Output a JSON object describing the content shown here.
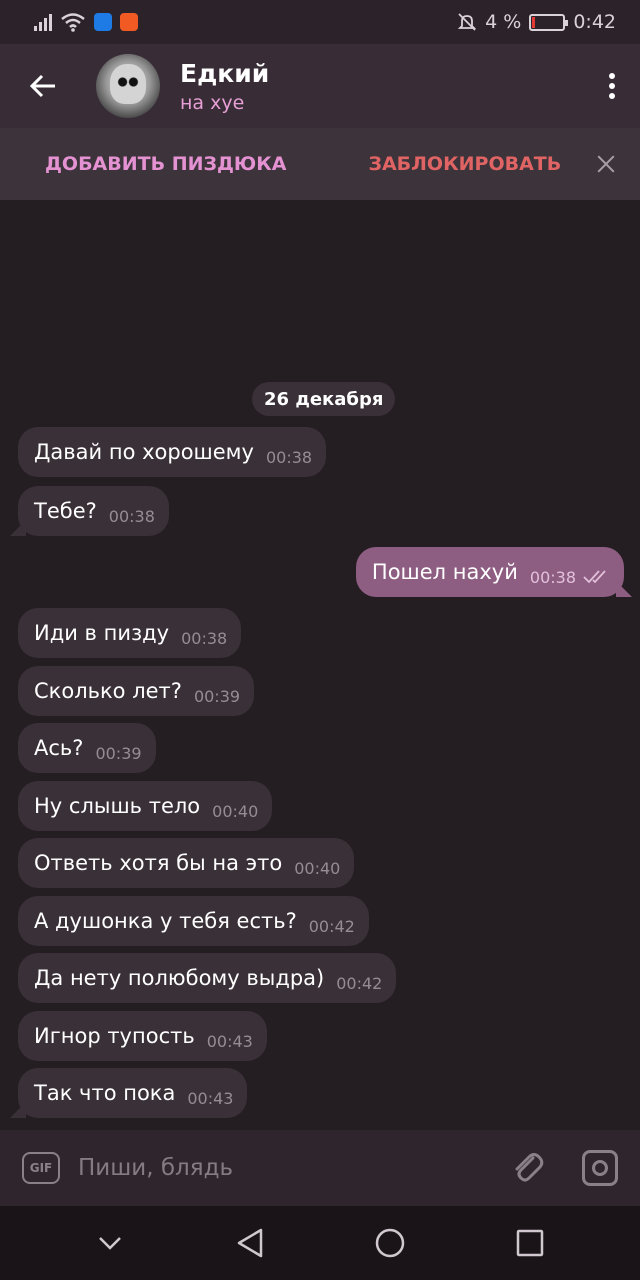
{
  "status_bar": {
    "battery_percent": "4 %",
    "time": "0:42",
    "icons": [
      "signal-icon",
      "wifi-icon",
      "shield-app-icon",
      "aliexpress-app-icon",
      "mute-bell-icon",
      "battery-icon"
    ],
    "battery_level": 0.04,
    "battery_color": "#e53935"
  },
  "header": {
    "title": "Едкий",
    "subtitle": "на хуе",
    "subtitle_color": "#e79fd5"
  },
  "action_bar": {
    "add_label": "ДОБАВИТЬ ПИЗДЮКА",
    "block_label": "ЗАБЛОКИРОВАТЬ",
    "add_color": "#e592d2",
    "block_color": "#e06464"
  },
  "chat": {
    "date": "26 декабря",
    "messages": [
      {
        "text": "Давай по хорошему",
        "time": "00:38",
        "outgoing": false
      },
      {
        "text": "Тебе?",
        "time": "00:38",
        "outgoing": false
      },
      {
        "text": "Пошел нахуй",
        "time": "00:38",
        "outgoing": true,
        "status": "read"
      },
      {
        "text": "Иди в пизду",
        "time": "00:38",
        "outgoing": false
      },
      {
        "text": "Сколько лет?",
        "time": "00:39",
        "outgoing": false
      },
      {
        "text": "Ась?",
        "time": "00:39",
        "outgoing": false
      },
      {
        "text": "Ну слышь тело",
        "time": "00:40",
        "outgoing": false
      },
      {
        "text": "Ответь хотя бы на это",
        "time": "00:40",
        "outgoing": false
      },
      {
        "text": "А душонка у тебя есть?",
        "time": "00:42",
        "outgoing": false
      },
      {
        "text": "Да нету полюбому выдра)",
        "time": "00:42",
        "outgoing": false
      },
      {
        "text": "Игнор тупость",
        "time": "00:43",
        "outgoing": false
      },
      {
        "text": "Так что пока",
        "time": "00:43",
        "outgoing": false
      }
    ]
  },
  "input": {
    "placeholder": "Пиши, блядь",
    "gif_label": "GIF"
  },
  "colors": {
    "background": "#241d22",
    "incoming_bubble": "#3a3038",
    "outgoing_bubble": "#8e5d82",
    "header": "#382d36"
  }
}
